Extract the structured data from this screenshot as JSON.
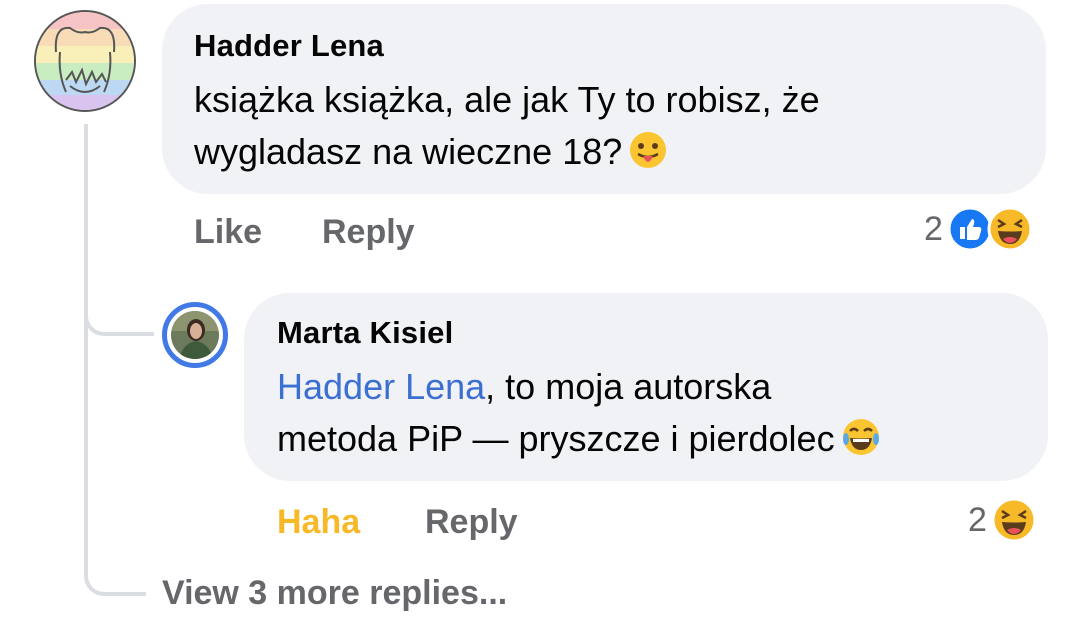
{
  "comment": {
    "author": "Hadder Lena",
    "text_line1": "książka książka, ale jak Ty to robisz, że",
    "text_line2": "wygladasz na wieczne 18?",
    "like_label": "Like",
    "reply_label": "Reply",
    "reaction_count": "2",
    "reactions": [
      "like-icon",
      "haha-icon"
    ]
  },
  "reply": {
    "author": "Marta Kisiel",
    "mention": "Hadder Lena",
    "text_line1_rest": ", to moja autorska",
    "text_line2": "metoda PiP — pryszcze i pierdolec",
    "reaction_label": "Haha",
    "reply_label": "Reply",
    "reaction_count": "2",
    "reactions": [
      "haha-icon"
    ]
  },
  "view_more_label": "View 3 more replies...",
  "colors": {
    "bubble": "#f0f2f5",
    "muted_text": "#65676b",
    "mention": "#3b6fd1",
    "haha": "#f7b928",
    "like_blue": "#1877f2",
    "avatar_ring": "#4179e6"
  }
}
